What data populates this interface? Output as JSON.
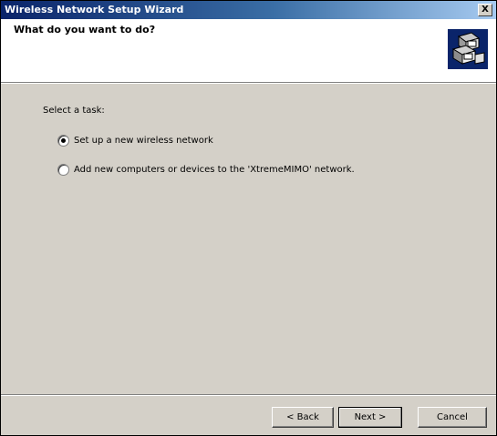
{
  "window": {
    "title": "Wireless Network Setup Wizard",
    "close_label": "X"
  },
  "header": {
    "title": "What do you want to do?",
    "icon": "computers-network-icon"
  },
  "content": {
    "task_label": "Select a task:",
    "options": [
      {
        "label": "Set up a new wireless network",
        "selected": true
      },
      {
        "label": "Add new computers or devices to the 'XtremeMIMO' network.",
        "selected": false
      }
    ]
  },
  "buttons": {
    "back": "< Back",
    "next": "Next >",
    "cancel": "Cancel"
  },
  "colors": {
    "titlebar": "#0a246a",
    "dialog_face": "#d4d0c8",
    "header_bg": "#ffffff"
  }
}
